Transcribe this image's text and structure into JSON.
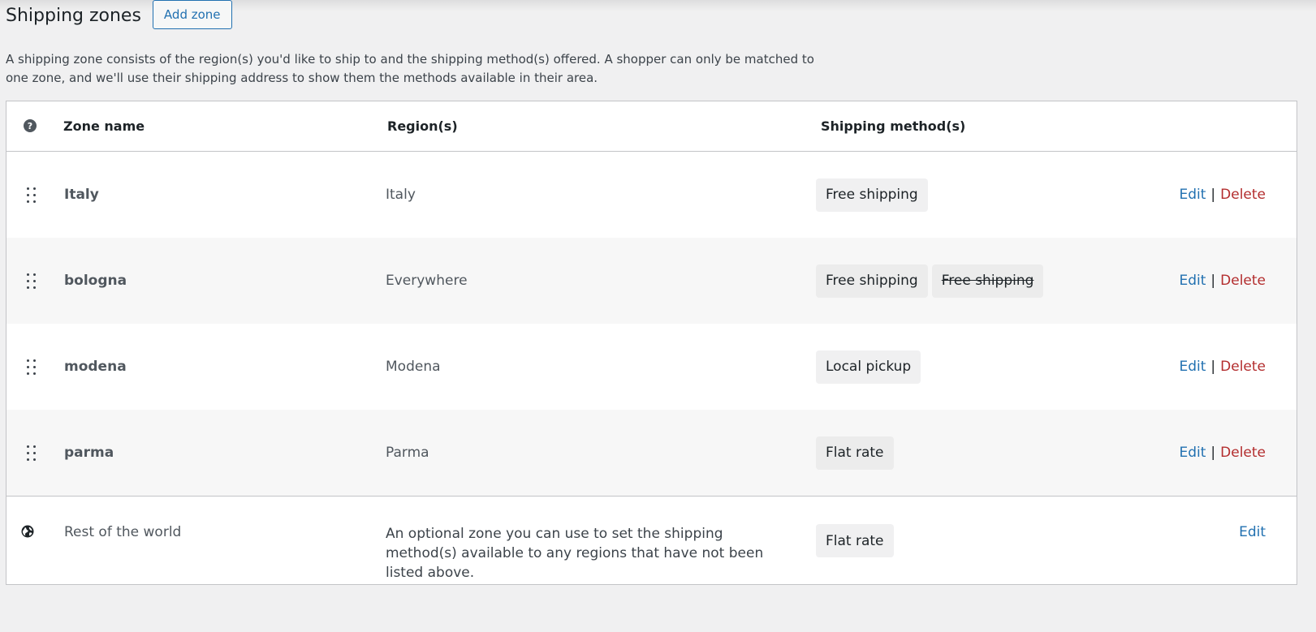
{
  "header": {
    "title": "Shipping zones",
    "add_zone_label": "Add zone"
  },
  "description": "A shipping zone consists of the region(s) you'd like to ship to and the shipping method(s) offered. A shopper can only be matched to one zone, and we'll use their shipping address to show them the methods available in their area.",
  "table": {
    "help_icon": "?",
    "columns": {
      "zone_name": "Zone name",
      "regions": "Region(s)",
      "methods": "Shipping method(s)"
    },
    "rows": [
      {
        "name": "Italy",
        "region": "Italy",
        "methods": [
          {
            "label": "Free shipping",
            "enabled": true
          }
        ],
        "edit_label": "Edit",
        "separator": "|",
        "delete_label": "Delete"
      },
      {
        "name": "bologna",
        "region": "Everywhere",
        "methods": [
          {
            "label": "Free shipping",
            "enabled": true
          },
          {
            "label": "Free shipping",
            "enabled": false
          }
        ],
        "edit_label": "Edit",
        "separator": "|",
        "delete_label": "Delete"
      },
      {
        "name": "modena",
        "region": "Modena",
        "methods": [
          {
            "label": "Local pickup",
            "enabled": true
          }
        ],
        "edit_label": "Edit",
        "separator": "|",
        "delete_label": "Delete"
      },
      {
        "name": "parma",
        "region": "Parma",
        "methods": [
          {
            "label": "Flat rate",
            "enabled": true
          }
        ],
        "edit_label": "Edit",
        "separator": "|",
        "delete_label": "Delete"
      }
    ],
    "rest_of_world": {
      "icon": "globe-icon",
      "name": "Rest of the world",
      "description": "An optional zone you can use to set the shipping method(s) available to any regions that have not been listed above.",
      "method": "Flat rate",
      "edit_label": "Edit"
    }
  },
  "colors": {
    "background": "#f0f0f1",
    "link": "#2271b1",
    "delete": "#b32d2e",
    "pill": "#f0f0f1"
  }
}
